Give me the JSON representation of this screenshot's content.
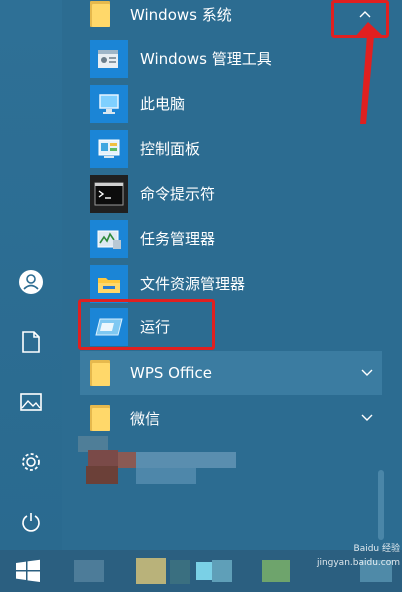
{
  "start_menu": {
    "group_windows_system": "Windows 系统",
    "apps": [
      {
        "label": "Windows 管理工具",
        "icon": "admin-tools-icon"
      },
      {
        "label": "此电脑",
        "icon": "this-pc-icon"
      },
      {
        "label": "控制面板",
        "icon": "control-panel-icon"
      },
      {
        "label": "命令提示符",
        "icon": "command-prompt-icon"
      },
      {
        "label": "任务管理器",
        "icon": "task-manager-icon"
      },
      {
        "label": "文件资源管理器",
        "icon": "file-explorer-icon"
      },
      {
        "label": "运行",
        "icon": "run-icon"
      }
    ],
    "group_wps": "WPS Office",
    "group_wechat": "微信"
  },
  "watermark": "Baidu 经验\njingyan.baidu.com",
  "colors": {
    "background": "#2d6e92",
    "tile_blue": "#1b85d6",
    "folder_yellow": "#ffd86a",
    "highlight_red": "#e02020",
    "selected_row": "#3b7ca1"
  }
}
